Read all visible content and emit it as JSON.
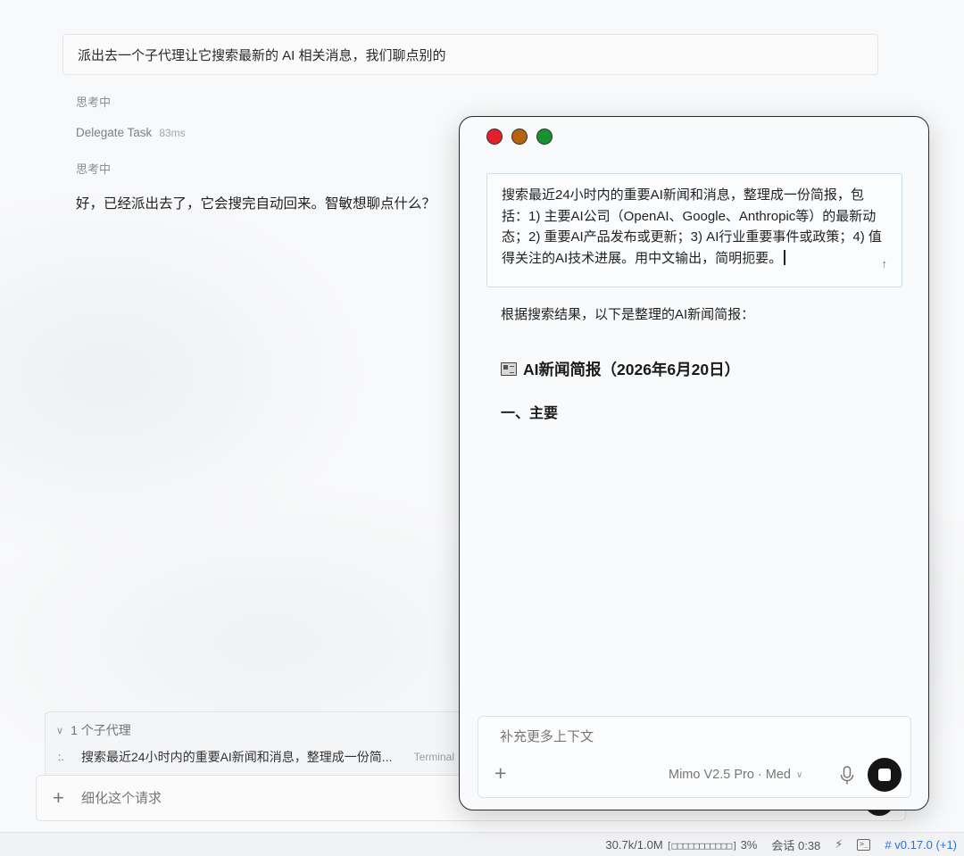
{
  "main": {
    "prompt": "派出去一个子代理让它搜索最新的 AI 相关消息，我们聊点别的",
    "thinking_1": "思考中",
    "delegate_label": "Delegate Task",
    "delegate_time": "83ms",
    "thinking_2": "思考中",
    "reply": "好，已经派出去了，它会搜完自动回来。智敏想聊点什么？"
  },
  "subagents": {
    "header": "1 个子代理",
    "items": [
      {
        "spinner": ":.",
        "text": "搜索最近24小时内的重要AI新闻和消息，整理成一份简...",
        "tag": "Terminal"
      }
    ]
  },
  "main_input": {
    "placeholder": "细化这个请求"
  },
  "status": {
    "tokens": "30.7k/1.0M",
    "progress_bar": "[□□□□□□□□□□□]",
    "percent": "3%",
    "session": "会话 0:38",
    "version": "# v0.17.0 (+1)"
  },
  "window": {
    "task_text": "搜索最近24小时内的重要AI新闻和消息，整理成一份简报，包括：1) 主要AI公司（OpenAI、Google、Anthropic等）的最新动态；2) 重要AI产品发布或更新；3) AI行业重要事件或政策；4) 值得关注的AI技术进展。用中文输出，简明扼要。",
    "intro": "根据搜索结果，以下是整理的AI新闻简报：",
    "heading": "AI新闻简报（2026年6月20日）",
    "subheading": "一、主要",
    "composer_placeholder": "补充更多上下文",
    "model": "Mimo V2.5 Pro · Med"
  },
  "colors": {
    "close": "#e5202a",
    "minimize": "#b8620e",
    "zoom": "#16922e",
    "version": "#2f6fd6"
  },
  "icons": [
    "chevron-down-icon",
    "plus-icon",
    "arrow-up-icon",
    "newspaper-icon",
    "mic-icon",
    "stop-icon",
    "lightning-icon",
    "terminal-icon"
  ]
}
